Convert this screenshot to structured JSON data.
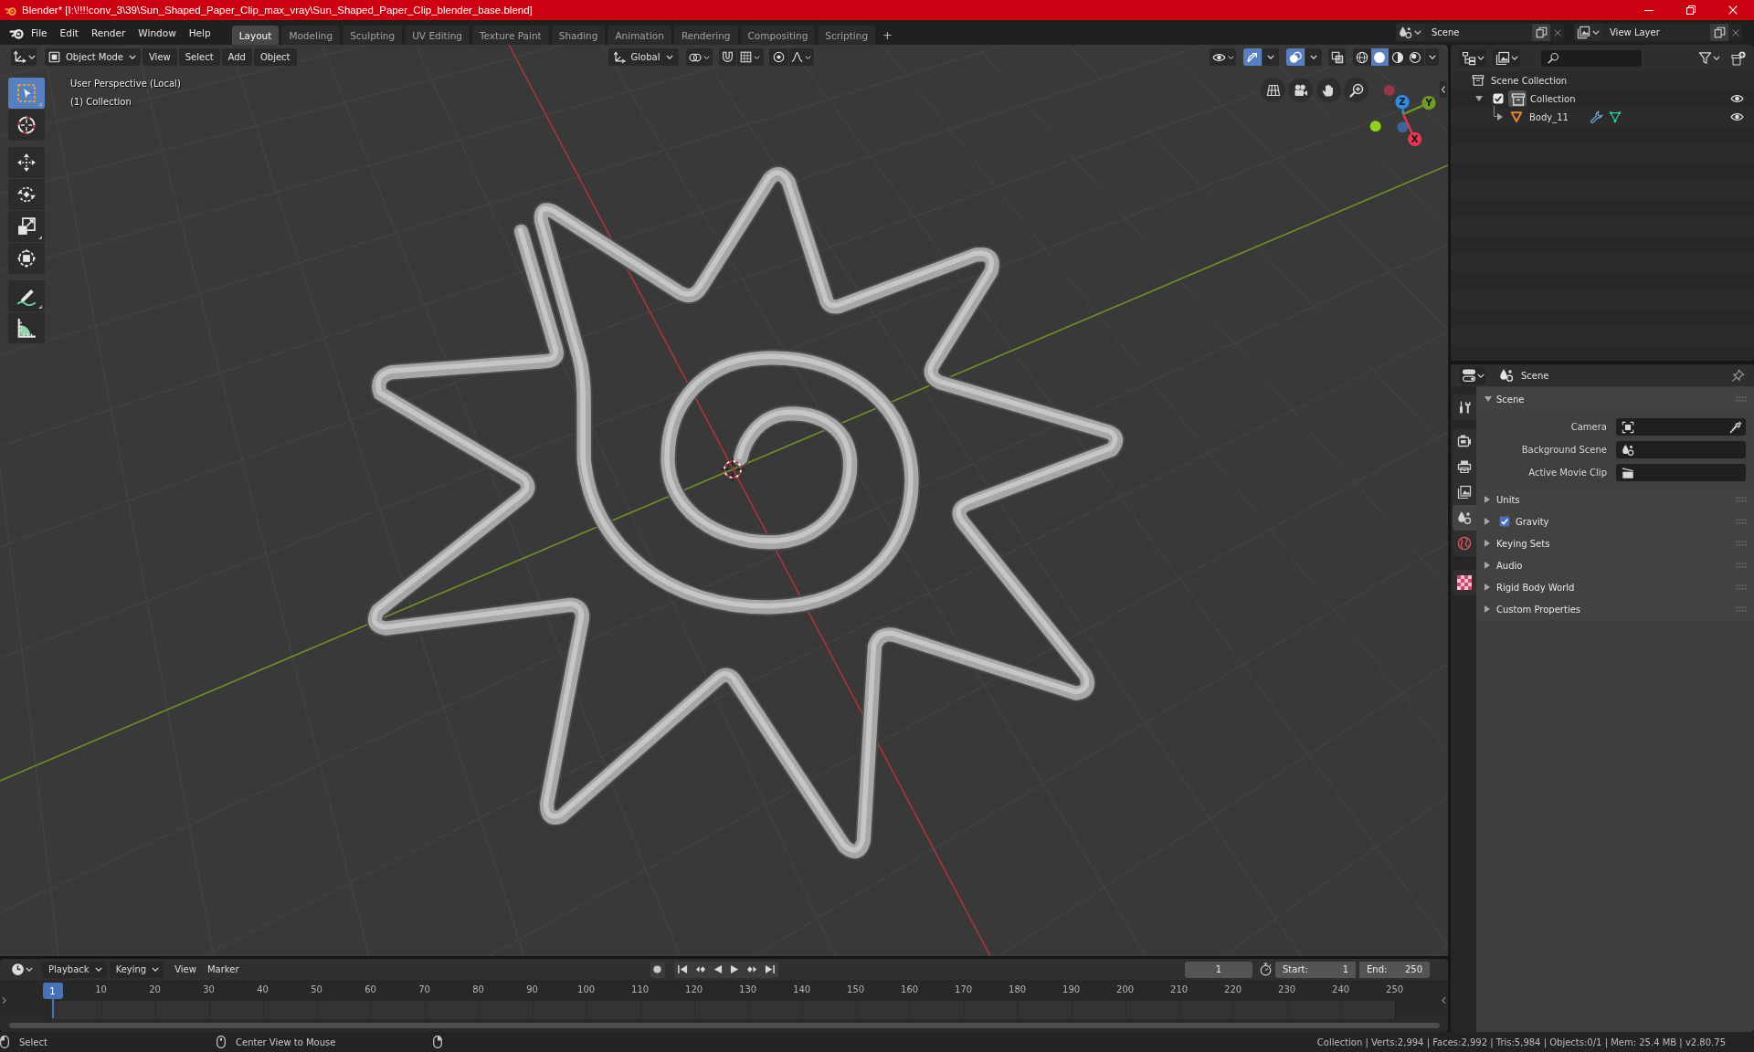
{
  "window": {
    "title": "Blender* [I:\\!!!!conv_3\\39\\Sun_Shaped_Paper_Clip_max_vray\\Sun_Shaped_Paper_Clip_blender_base.blend]"
  },
  "top_bar": {
    "menus": [
      "File",
      "Edit",
      "Render",
      "Window",
      "Help"
    ],
    "workspaces": [
      {
        "label": "Layout",
        "selected": true
      },
      {
        "label": "Modeling",
        "selected": false
      },
      {
        "label": "Sculpting",
        "selected": false
      },
      {
        "label": "UV Editing",
        "selected": false
      },
      {
        "label": "Texture Paint",
        "selected": false
      },
      {
        "label": "Shading",
        "selected": false
      },
      {
        "label": "Animation",
        "selected": false
      },
      {
        "label": "Rendering",
        "selected": false
      },
      {
        "label": "Compositing",
        "selected": false
      },
      {
        "label": "Scripting",
        "selected": false
      }
    ],
    "add_workspace": "+",
    "scene": "Scene",
    "view_layer": "View Layer"
  },
  "viewport": {
    "header": {
      "mode": "Object Mode",
      "menus": [
        "View",
        "Select",
        "Add",
        "Object"
      ],
      "orientation": "Global",
      "toggles": [
        {
          "kind": "gizmos",
          "on": true
        },
        {
          "kind": "overlays",
          "on": true
        },
        {
          "kind": "xray",
          "on": false
        }
      ],
      "shading": [
        {
          "kind": "wireframe",
          "selected": false
        },
        {
          "kind": "solid",
          "selected": true
        },
        {
          "kind": "material",
          "selected": false
        },
        {
          "kind": "rendered",
          "selected": false
        }
      ]
    },
    "toolbar": [
      {
        "tools": [
          {
            "kind": "select_box",
            "selected": true
          },
          {
            "kind": "cursor",
            "selected": false
          }
        ]
      },
      {
        "tools": [
          {
            "kind": "move",
            "selected": false
          },
          {
            "kind": "rotate",
            "selected": false
          },
          {
            "kind": "scale",
            "selected": false
          },
          {
            "kind": "transform",
            "selected": false
          }
        ]
      },
      {
        "tools": [
          {
            "kind": "annotate",
            "selected": false
          },
          {
            "kind": "measure",
            "selected": false
          }
        ]
      }
    ],
    "overlay_text": [
      "User Perspective (Local)",
      "(1) Collection"
    ],
    "gizmo": {
      "axes": [
        {
          "label": "Z",
          "color": "#2e8ce6"
        },
        {
          "label": "Y",
          "color": "#6e9b22"
        },
        {
          "label": "X",
          "color": "#e8364e"
        }
      ]
    }
  },
  "outliner": {
    "tree": [
      {
        "label": "Scene Collection",
        "kind": "scene_collection",
        "children": [
          {
            "label": "Collection",
            "kind": "collection",
            "expanded": true,
            "checked": true,
            "active": true,
            "visible": true,
            "children": [
              {
                "label": "Body_11",
                "kind": "mesh_object",
                "expanded": false,
                "visible": true
              }
            ]
          }
        ]
      }
    ]
  },
  "properties": {
    "context": "Scene",
    "tab_groups": [
      {
        "tabs": [
          {
            "kind": "tool",
            "selected": false
          }
        ]
      },
      {
        "tabs": [
          {
            "kind": "render",
            "selected": false
          },
          {
            "kind": "output",
            "selected": false
          },
          {
            "kind": "view_layer",
            "selected": false
          },
          {
            "kind": "scene",
            "selected": true
          },
          {
            "kind": "world",
            "selected": false
          }
        ]
      },
      {
        "tabs": [
          {
            "kind": "texture",
            "selected": false
          }
        ]
      }
    ],
    "panels": [
      {
        "label": "Scene",
        "expanded": true,
        "fields": [
          {
            "label": "Camera",
            "kind": "camera"
          },
          {
            "label": "Background Scene",
            "kind": "scene"
          },
          {
            "label": "Active Movie Clip",
            "kind": "movie_clip"
          }
        ]
      },
      {
        "label": "Units",
        "expanded": false
      },
      {
        "label": "Gravity",
        "expanded": false,
        "checkbox": {
          "checked": true
        }
      },
      {
        "label": "Keying Sets",
        "expanded": false
      },
      {
        "label": "Audio",
        "expanded": false
      },
      {
        "label": "Rigid Body World",
        "expanded": false
      },
      {
        "label": "Custom Properties",
        "expanded": false
      }
    ]
  },
  "timeline": {
    "menus": [
      {
        "label": "Playback",
        "kind": "dropdown"
      },
      {
        "label": "Keying",
        "kind": "dropdown"
      },
      {
        "label": "View",
        "kind": "menu"
      },
      {
        "label": "Marker",
        "kind": "menu"
      }
    ],
    "current_frame": "1",
    "start": {
      "label": "Start:",
      "value": "1"
    },
    "end": {
      "label": "End:",
      "value": "250"
    },
    "playhead": "1",
    "ruler": [
      "10",
      "20",
      "30",
      "40",
      "50",
      "60",
      "70",
      "80",
      "90",
      "100",
      "110",
      "120",
      "130",
      "140",
      "150",
      "160",
      "170",
      "180",
      "190",
      "200",
      "210",
      "220",
      "230",
      "240",
      "250"
    ]
  },
  "status_bar": {
    "hints": [
      {
        "kind": "left_click",
        "label": "Select"
      },
      {
        "kind": "middle_click",
        "label": "Center View to Mouse"
      },
      {
        "kind": "right_click"
      }
    ],
    "stats": "Collection | Verts:2,994 | Faces:2,992 | Tris:5,984 | Objects:0/1 | Mem: 25.4 MB | v2.80.75"
  }
}
